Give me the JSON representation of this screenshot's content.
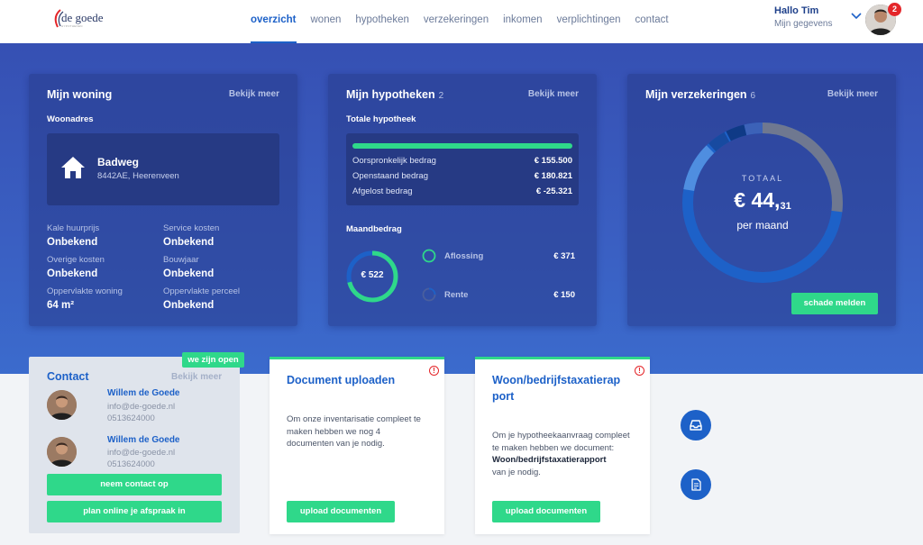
{
  "logo": {
    "name": "de goede",
    "sub": "HYPOTHEKEN"
  },
  "nav": [
    {
      "label": "overzicht",
      "active": true
    },
    {
      "label": "wonen"
    },
    {
      "label": "hypotheken"
    },
    {
      "label": "verzekeringen"
    },
    {
      "label": "inkomen"
    },
    {
      "label": "verplichtingen"
    },
    {
      "label": "contact"
    }
  ],
  "user": {
    "greeting": "Hallo Tim",
    "link": "Mijn gegevens",
    "notifications": "2"
  },
  "woning": {
    "title": "Mijn woning",
    "more": "Bekijk meer",
    "address_label": "Woonadres",
    "street": "Badweg",
    "city": "8442AE, Heerenveen",
    "props": [
      {
        "label": "Kale huurprijs",
        "value": "Onbekend"
      },
      {
        "label": "Service kosten",
        "value": "Onbekend"
      },
      {
        "label": "Overige kosten",
        "value": "Onbekend"
      },
      {
        "label": "Bouwjaar",
        "value": "Onbekend"
      },
      {
        "label": "Oppervlakte woning",
        "value": "64 m²"
      },
      {
        "label": "Oppervlakte perceel",
        "value": "Onbekend"
      }
    ]
  },
  "hypotheken": {
    "title": "Mijn hypotheken",
    "count": "2",
    "more": "Bekijk meer",
    "total_label": "Totale hypotheek",
    "rows": [
      {
        "label": "Oorspronkelijk bedrag",
        "value": "€ 155.500"
      },
      {
        "label": "Openstaand bedrag",
        "value": "€ 180.821"
      },
      {
        "label": "Afgelost bedrag",
        "value": "€ -25.321"
      }
    ],
    "monthly_label": "Maandbedrag",
    "monthly_total": "€ 522",
    "legend": [
      {
        "label": "Aflossing",
        "value": "€ 371",
        "color": "#2fd88a"
      },
      {
        "label": "Rente",
        "value": "€ 150",
        "color": "#1d61c8"
      }
    ]
  },
  "verzekeringen": {
    "title": "Mijn verzekeringen",
    "count": "6",
    "more": "Bekijk meer",
    "total_label": "TOTAAL",
    "total_main": "€ 44,",
    "total_cents": "31",
    "per": "per maand",
    "button": "schade melden"
  },
  "contact": {
    "badge": "we zijn open",
    "title": "Contact",
    "more": "Bekijk meer",
    "people": [
      {
        "name": "Willem de Goede",
        "email": "info@de-goede.nl",
        "phone": "0513624000"
      },
      {
        "name": "Willem de Goede",
        "email": "info@de-goede.nl",
        "phone": "0513624000"
      }
    ],
    "btn_contact": "neem contact op",
    "btn_appointment": "plan online je afspraak in"
  },
  "upload": {
    "title": "Document uploaden",
    "body": "Om onze inventarisatie compleet te maken hebben we nog 4 documenten van je nodig.",
    "button": "upload documenten"
  },
  "taxatie": {
    "title": "Woon/bedrijfstaxatierap port",
    "body_1": "Om je hypotheekaanvraag compleet te maken hebben we document:",
    "body_bold": "Woon/bedrijfstaxatierapport",
    "body_2": "van je nodig.",
    "button": "upload documenten"
  },
  "colors": {
    "primary": "#1d61c8",
    "accent_green": "#2fd88a",
    "hero": "#3a5fc2",
    "alert": "#e4262a"
  }
}
